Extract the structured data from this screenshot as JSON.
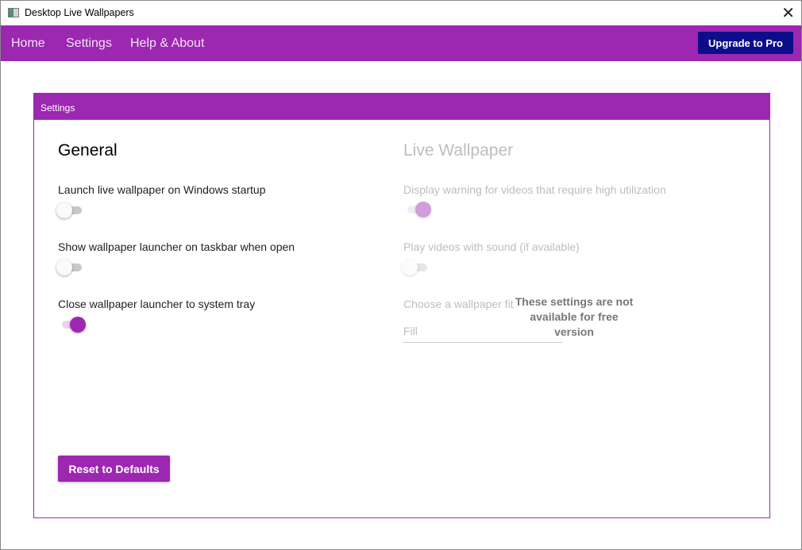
{
  "window": {
    "title": "Desktop Live Wallpapers"
  },
  "nav": {
    "items": [
      "Home",
      "Settings",
      "Help & About"
    ],
    "upgrade_label": "Upgrade to Pro"
  },
  "panel": {
    "title": "Settings",
    "general": {
      "heading": "General",
      "settings": [
        {
          "label": "Launch live wallpaper on Windows startup",
          "on": false
        },
        {
          "label": "Show wallpaper launcher on taskbar when open",
          "on": false
        },
        {
          "label": "Close wallpaper launcher to system tray",
          "on": true
        }
      ]
    },
    "live": {
      "heading": "Live Wallpaper",
      "settings": [
        {
          "label": "Display warning for videos that require high utilization",
          "on": true
        },
        {
          "label": "Play videos with sound (if available)",
          "on": false
        }
      ],
      "fit_label": "Choose a wallpaper fit",
      "fit_value": "Fill",
      "notice": "These settings are not available for free version"
    },
    "reset_label": "Reset to Defaults"
  }
}
